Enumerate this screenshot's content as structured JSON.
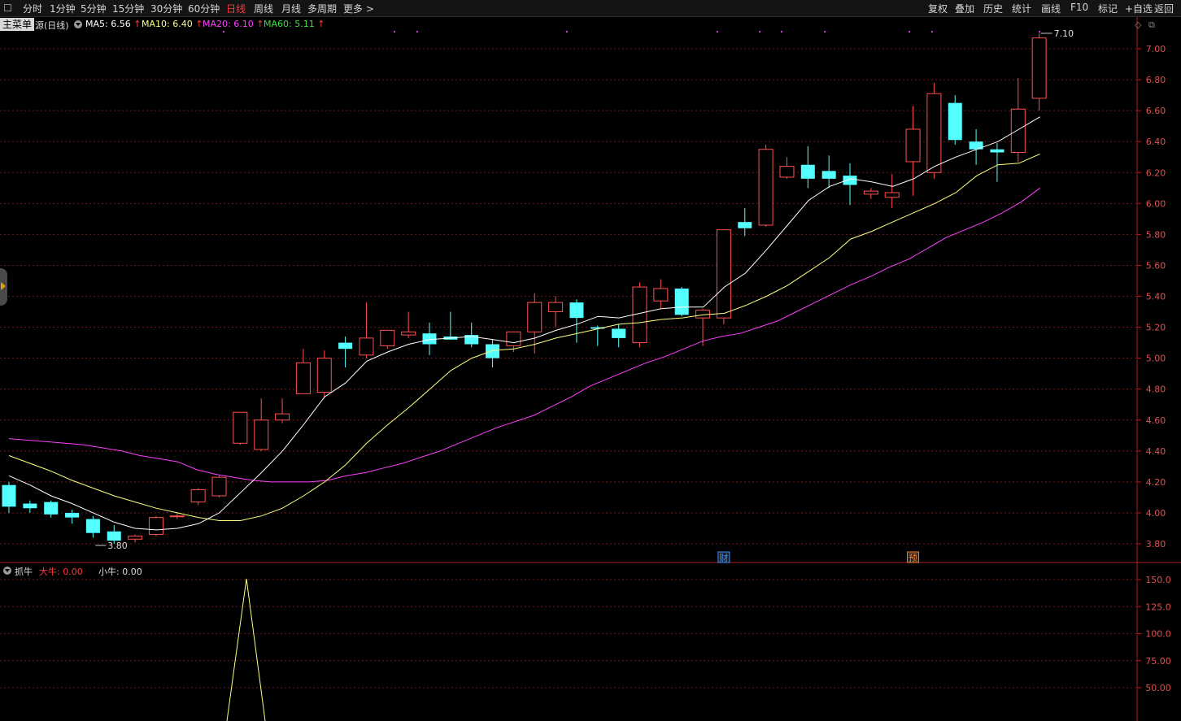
{
  "toolbar": {
    "left": [
      "分时",
      "1分钟",
      "5分钟",
      "15分钟",
      "30分钟",
      "60分钟",
      "日线",
      "周线",
      "月线",
      "多周期",
      "更多 >"
    ],
    "active_index": 6,
    "right": [
      "复权",
      "叠加",
      "历史",
      "统计",
      "画线",
      "F10",
      "标记",
      "+自选",
      "返回"
    ]
  },
  "main_menu": "主菜单",
  "indicator_name": "源(日线)",
  "ma_legend": [
    {
      "label": "MA5: 6.56",
      "color": "#ffffff"
    },
    {
      "label": "MA10: 6.40",
      "color": "#ffff80"
    },
    {
      "label": "MA20: 6.10",
      "color": "#ff40ff"
    },
    {
      "label": "MA60: 5.11",
      "color": "#40e040"
    }
  ],
  "sub_legend": {
    "name": "抓牛",
    "big_label": "大牛: 0.00",
    "small_label": "小牛: 0.00"
  },
  "events": [
    {
      "label": "财",
      "index": 34,
      "color": "#4090ff"
    },
    {
      "label": "预",
      "index": 43,
      "color": "#ff8030"
    }
  ],
  "colors": {
    "up": "#ff5050",
    "down": "#54ffff",
    "grid": "#701818",
    "axis_text": "#e05050"
  },
  "chart_data": {
    "type": "candlestick",
    "y_ticks": [
      "7.00",
      "6.80",
      "6.60",
      "6.40",
      "6.20",
      "6.00",
      "5.80",
      "5.60",
      "5.40",
      "5.20",
      "5.00",
      "4.80",
      "4.60",
      "4.40",
      "4.20",
      "4.00",
      "3.80"
    ],
    "ylim": [
      3.75,
      7.2
    ],
    "high_label": "7.10",
    "low_label": "3.80",
    "ohlc": [
      [
        4.18,
        4.2,
        4.0,
        4.04
      ],
      [
        4.06,
        4.08,
        4.0,
        4.03
      ],
      [
        4.07,
        4.08,
        3.97,
        3.99
      ],
      [
        4.0,
        4.02,
        3.93,
        3.97
      ],
      [
        3.96,
        3.98,
        3.84,
        3.87
      ],
      [
        3.88,
        3.92,
        3.8,
        3.82
      ],
      [
        3.83,
        3.86,
        3.81,
        3.85
      ],
      [
        3.86,
        3.98,
        3.85,
        3.97
      ],
      [
        3.98,
        4.0,
        3.96,
        3.98
      ],
      [
        4.07,
        4.16,
        4.05,
        4.15
      ],
      [
        4.11,
        4.24,
        4.1,
        4.23
      ],
      [
        4.45,
        4.65,
        4.44,
        4.65
      ],
      [
        4.41,
        4.74,
        4.4,
        4.6
      ],
      [
        4.6,
        4.74,
        4.58,
        4.64
      ],
      [
        4.77,
        5.06,
        4.77,
        4.97
      ],
      [
        4.78,
        5.05,
        4.74,
        5.0
      ],
      [
        5.1,
        5.14,
        4.94,
        5.06
      ],
      [
        5.02,
        5.36,
        5.0,
        5.13
      ],
      [
        5.08,
        5.18,
        5.06,
        5.18
      ],
      [
        5.15,
        5.3,
        5.13,
        5.17
      ],
      [
        5.16,
        5.23,
        5.02,
        5.09
      ],
      [
        5.14,
        5.3,
        5.12,
        5.12
      ],
      [
        5.15,
        5.23,
        5.07,
        5.09
      ],
      [
        5.09,
        5.12,
        4.94,
        5.0
      ],
      [
        5.08,
        5.17,
        5.04,
        5.17
      ],
      [
        5.17,
        5.42,
        5.03,
        5.36
      ],
      [
        5.3,
        5.4,
        5.2,
        5.36
      ],
      [
        5.36,
        5.38,
        5.1,
        5.26
      ],
      [
        5.2,
        5.21,
        5.08,
        5.19
      ],
      [
        5.19,
        5.22,
        5.07,
        5.13
      ],
      [
        5.1,
        5.49,
        5.07,
        5.46
      ],
      [
        5.37,
        5.51,
        5.32,
        5.45
      ],
      [
        5.45,
        5.46,
        5.27,
        5.28
      ],
      [
        5.26,
        5.32,
        5.08,
        5.31
      ],
      [
        5.26,
        5.83,
        5.22,
        5.83
      ],
      [
        5.88,
        5.97,
        5.79,
        5.84
      ],
      [
        5.86,
        6.38,
        5.85,
        6.35
      ],
      [
        6.17,
        6.3,
        6.16,
        6.24
      ],
      [
        6.25,
        6.37,
        6.1,
        6.16
      ],
      [
        6.21,
        6.31,
        6.1,
        6.16
      ],
      [
        6.18,
        6.26,
        5.99,
        6.12
      ],
      [
        6.06,
        6.1,
        6.03,
        6.08
      ],
      [
        6.04,
        6.19,
        5.97,
        6.07
      ],
      [
        6.27,
        6.63,
        6.05,
        6.48
      ],
      [
        6.2,
        6.78,
        6.16,
        6.71
      ],
      [
        6.65,
        6.7,
        6.38,
        6.41
      ],
      [
        6.4,
        6.48,
        6.25,
        6.35
      ],
      [
        6.35,
        6.39,
        6.14,
        6.33
      ],
      [
        6.33,
        6.81,
        6.27,
        6.61
      ],
      [
        6.68,
        7.1,
        6.6,
        7.07
      ]
    ],
    "ma5": [
      4.24,
      4.18,
      4.11,
      4.06,
      4.0,
      3.94,
      3.9,
      3.89,
      3.9,
      3.93,
      4.0,
      4.13,
      4.26,
      4.4,
      4.57,
      4.75,
      4.84,
      4.98,
      5.04,
      5.09,
      5.12,
      5.13,
      5.14,
      5.12,
      5.1,
      5.13,
      5.18,
      5.22,
      5.27,
      5.26,
      5.29,
      5.32,
      5.33,
      5.33,
      5.46,
      5.55,
      5.7,
      5.86,
      6.02,
      6.11,
      6.16,
      6.14,
      6.11,
      6.16,
      6.24,
      6.3,
      6.35,
      6.4,
      6.48,
      6.56
    ],
    "ma10": [
      4.37,
      4.32,
      4.27,
      4.21,
      4.16,
      4.11,
      4.07,
      4.03,
      4.0,
      3.97,
      3.95,
      3.95,
      3.98,
      4.03,
      4.11,
      4.2,
      4.31,
      4.45,
      4.57,
      4.68,
      4.8,
      4.92,
      5.0,
      5.05,
      5.06,
      5.09,
      5.13,
      5.16,
      5.19,
      5.22,
      5.23,
      5.25,
      5.26,
      5.28,
      5.29,
      5.34,
      5.4,
      5.47,
      5.56,
      5.65,
      5.77,
      5.82,
      5.88,
      5.94,
      6.0,
      6.07,
      6.18,
      6.25,
      6.26,
      6.32
    ],
    "ma20": [
      4.48,
      4.47,
      4.46,
      4.45,
      4.44,
      4.42,
      4.4,
      4.37,
      4.35,
      4.33,
      4.28,
      4.25,
      4.23,
      4.21,
      4.2,
      4.2,
      4.2,
      4.21,
      4.24,
      4.26,
      4.29,
      4.32,
      4.36,
      4.4,
      4.45,
      4.5,
      4.55,
      4.59,
      4.63,
      4.69,
      4.75,
      4.82,
      4.87,
      4.92,
      4.97,
      5.01,
      5.06,
      5.11,
      5.14,
      5.16,
      5.2,
      5.24,
      5.3,
      5.36,
      5.42,
      5.48,
      5.53,
      5.59,
      5.64,
      5.71,
      5.78,
      5.83,
      5.88,
      5.94,
      6.01,
      6.1
    ]
  }
}
